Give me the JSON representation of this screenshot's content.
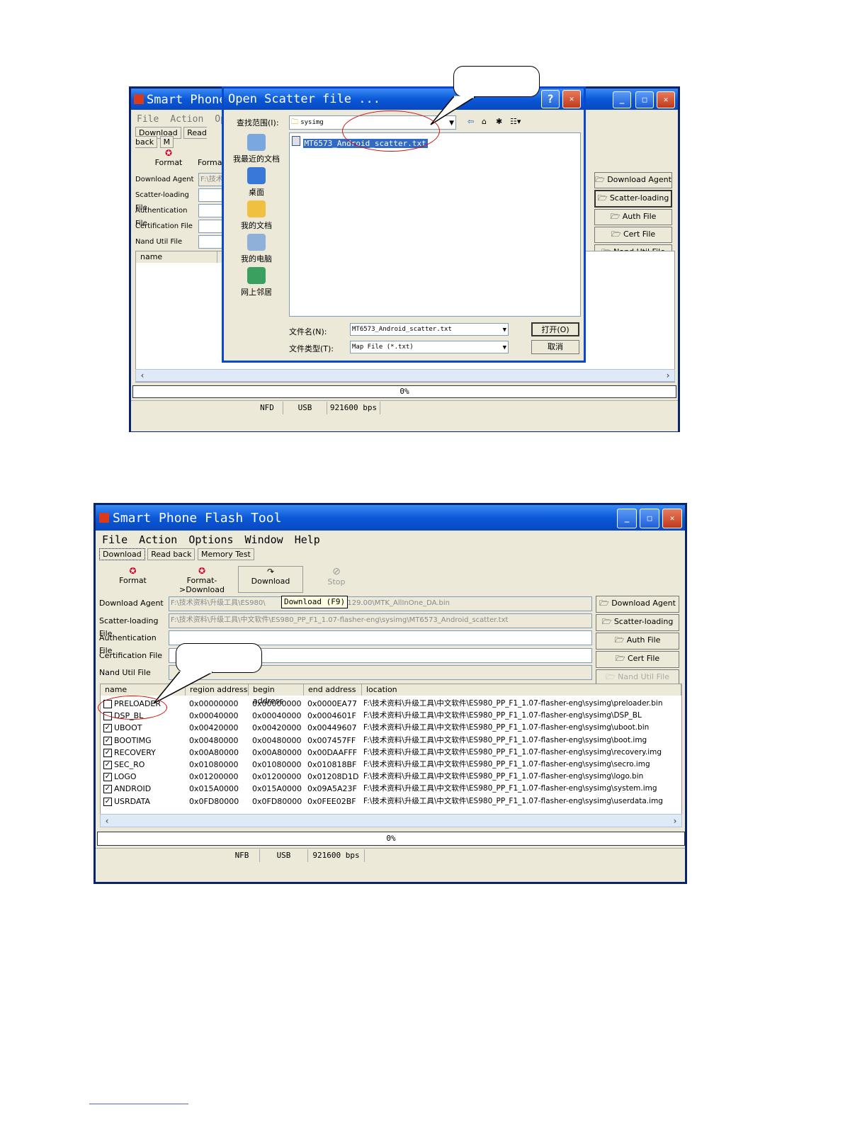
{
  "top_window": {
    "title": "Smart Phone Flash Tool",
    "menu": [
      "File",
      "Action",
      "Op"
    ],
    "tabs": [
      "Download",
      "Read back",
      "M"
    ],
    "toolbar": {
      "format": "Format",
      "format_download": "Format-"
    },
    "labels": [
      "Download Agent",
      "Scatter-loading File",
      "Authentication File",
      "Certification File",
      "Nand Util File"
    ],
    "download_agent_value": "F:\\技术",
    "side_buttons": [
      "Download Agent",
      "Scatter-loading",
      "Auth File",
      "Cert File",
      "Nand Util File"
    ],
    "list_header": [
      "name",
      "re"
    ],
    "progress": "0%",
    "status": {
      "storage": "NFD",
      "port": "USB",
      "baud": "921600 bps"
    }
  },
  "dialog": {
    "title": "Open Scatter file ...",
    "look_in_label": "查找范围(I):",
    "look_in_value": "sysimg",
    "places": [
      "我最近的文档",
      "桌面",
      "我的文档",
      "我的电脑",
      "网上邻居"
    ],
    "file_item": "MT6573_Android_scatter.txt",
    "filename_label": "文件名(N):",
    "filename_value": "MT6573_Android_scatter.txt",
    "filetype_label": "文件类型(T):",
    "filetype_value": "Map File (*.txt)",
    "open_button": "打开(O)",
    "cancel_button": "取消"
  },
  "bottom_window": {
    "title": "Smart Phone Flash Tool",
    "menu": [
      "File",
      "Action",
      "Options",
      "Window",
      "Help"
    ],
    "tabs": [
      "Download",
      "Read back",
      "Memory Test"
    ],
    "toolbar": {
      "format": "Format",
      "format_download": "Format->Download",
      "download": "Download",
      "stop": "Stop"
    },
    "labels": [
      "Download Agent",
      "Scatter-loading File",
      "Authentication File",
      "Certification File",
      "Nand Util File"
    ],
    "download_agent_value": "F:\\技术资料\\升级工具\\ES980\\",
    "download_agent_value_tail": "v2.1129.00\\MTK_AllInOne_DA.bin",
    "tooltip": "Download (F9)",
    "scatter_value": "F:\\技术资料\\升级工具\\中文软件\\ES980_PP_F1_1.07-flasher-eng\\sysimg\\MT6573_Android_scatter.txt",
    "side_buttons": [
      "Download Agent",
      "Scatter-loading",
      "Auth File",
      "Cert File",
      "Nand Util File"
    ],
    "columns": [
      "name",
      "region address",
      "begin address",
      "end address",
      "location"
    ],
    "rows": [
      {
        "name": "PRELOADER",
        "checked": false,
        "region": "0x00000000",
        "begin": "0x00000000",
        "end": "0x0000EA77",
        "location": "F:\\技术资料\\升级工具\\中文软件\\ES980_PP_F1_1.07-flasher-eng\\sysimg\\preloader.bin"
      },
      {
        "name": "DSP_BL",
        "checked": false,
        "region": "0x00040000",
        "begin": "0x00040000",
        "end": "0x0004601F",
        "location": "F:\\技术资料\\升级工具\\中文软件\\ES980_PP_F1_1.07-flasher-eng\\sysimg\\DSP_BL"
      },
      {
        "name": "UBOOT",
        "checked": true,
        "region": "0x00420000",
        "begin": "0x00420000",
        "end": "0x00449607",
        "location": "F:\\技术资料\\升级工具\\中文软件\\ES980_PP_F1_1.07-flasher-eng\\sysimg\\uboot.bin"
      },
      {
        "name": "BOOTIMG",
        "checked": true,
        "region": "0x00480000",
        "begin": "0x00480000",
        "end": "0x007457FF",
        "location": "F:\\技术资料\\升级工具\\中文软件\\ES980_PP_F1_1.07-flasher-eng\\sysimg\\boot.img"
      },
      {
        "name": "RECOVERY",
        "checked": true,
        "region": "0x00A80000",
        "begin": "0x00A80000",
        "end": "0x00DAAFFF",
        "location": "F:\\技术资料\\升级工具\\中文软件\\ES980_PP_F1_1.07-flasher-eng\\sysimg\\recovery.img"
      },
      {
        "name": "SEC_RO",
        "checked": true,
        "region": "0x01080000",
        "begin": "0x01080000",
        "end": "0x010818BF",
        "location": "F:\\技术资料\\升级工具\\中文软件\\ES980_PP_F1_1.07-flasher-eng\\sysimg\\secro.img"
      },
      {
        "name": "LOGO",
        "checked": true,
        "region": "0x01200000",
        "begin": "0x01200000",
        "end": "0x01208D1D",
        "location": "F:\\技术资料\\升级工具\\中文软件\\ES980_PP_F1_1.07-flasher-eng\\sysimg\\logo.bin"
      },
      {
        "name": "ANDROID",
        "checked": true,
        "region": "0x015A0000",
        "begin": "0x015A0000",
        "end": "0x09A5A23F",
        "location": "F:\\技术资料\\升级工具\\中文软件\\ES980_PP_F1_1.07-flasher-eng\\sysimg\\system.img"
      },
      {
        "name": "USRDATA",
        "checked": true,
        "region": "0x0FD80000",
        "begin": "0x0FD80000",
        "end": "0x0FEE02BF",
        "location": "F:\\技术资料\\升级工具\\中文软件\\ES980_PP_F1_1.07-flasher-eng\\sysimg\\userdata.img"
      }
    ],
    "progress": "0%",
    "status": {
      "storage": "NFB",
      "port": "USB",
      "baud": "921600 bps"
    }
  }
}
